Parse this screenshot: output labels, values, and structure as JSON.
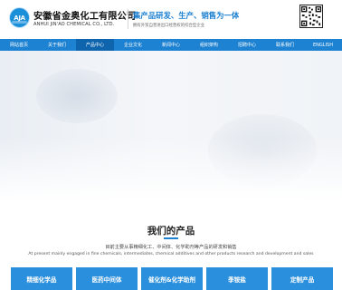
{
  "header": {
    "logo_text": "AJA",
    "company_cn": "安徽省金奥化工有限公司",
    "company_en": "ANHUI JIN'AO CHEMICAL CO., LTD.",
    "slogan": "集产品研发、生产、销售为一体",
    "subslogan": "拥有外贸自营进出口经营权的综合型企业"
  },
  "nav": {
    "items": [
      "网站首页",
      "关于我们",
      "产品中心",
      "企业文化",
      "新闻中心",
      "组织架构",
      "招聘中心",
      "联系我们",
      "ENGLISH"
    ],
    "active_index": 2
  },
  "products": {
    "title": "我们的产品",
    "desc_cn": "目前主要从事精细化工、中间体、化学助剂等产品的研发和销售",
    "desc_en": "At present mainly engaged in fine chemicals, intermediates, chemical additives and other products research and development and sales",
    "categories": [
      "精细化学品",
      "医药中间体",
      "催化剂&化学助剂",
      "季铵盐",
      "定制产品"
    ]
  },
  "colors": {
    "primary": "#1d82d1",
    "nav_active": "#0f65ad",
    "category_bg": "#2a8fdc"
  }
}
